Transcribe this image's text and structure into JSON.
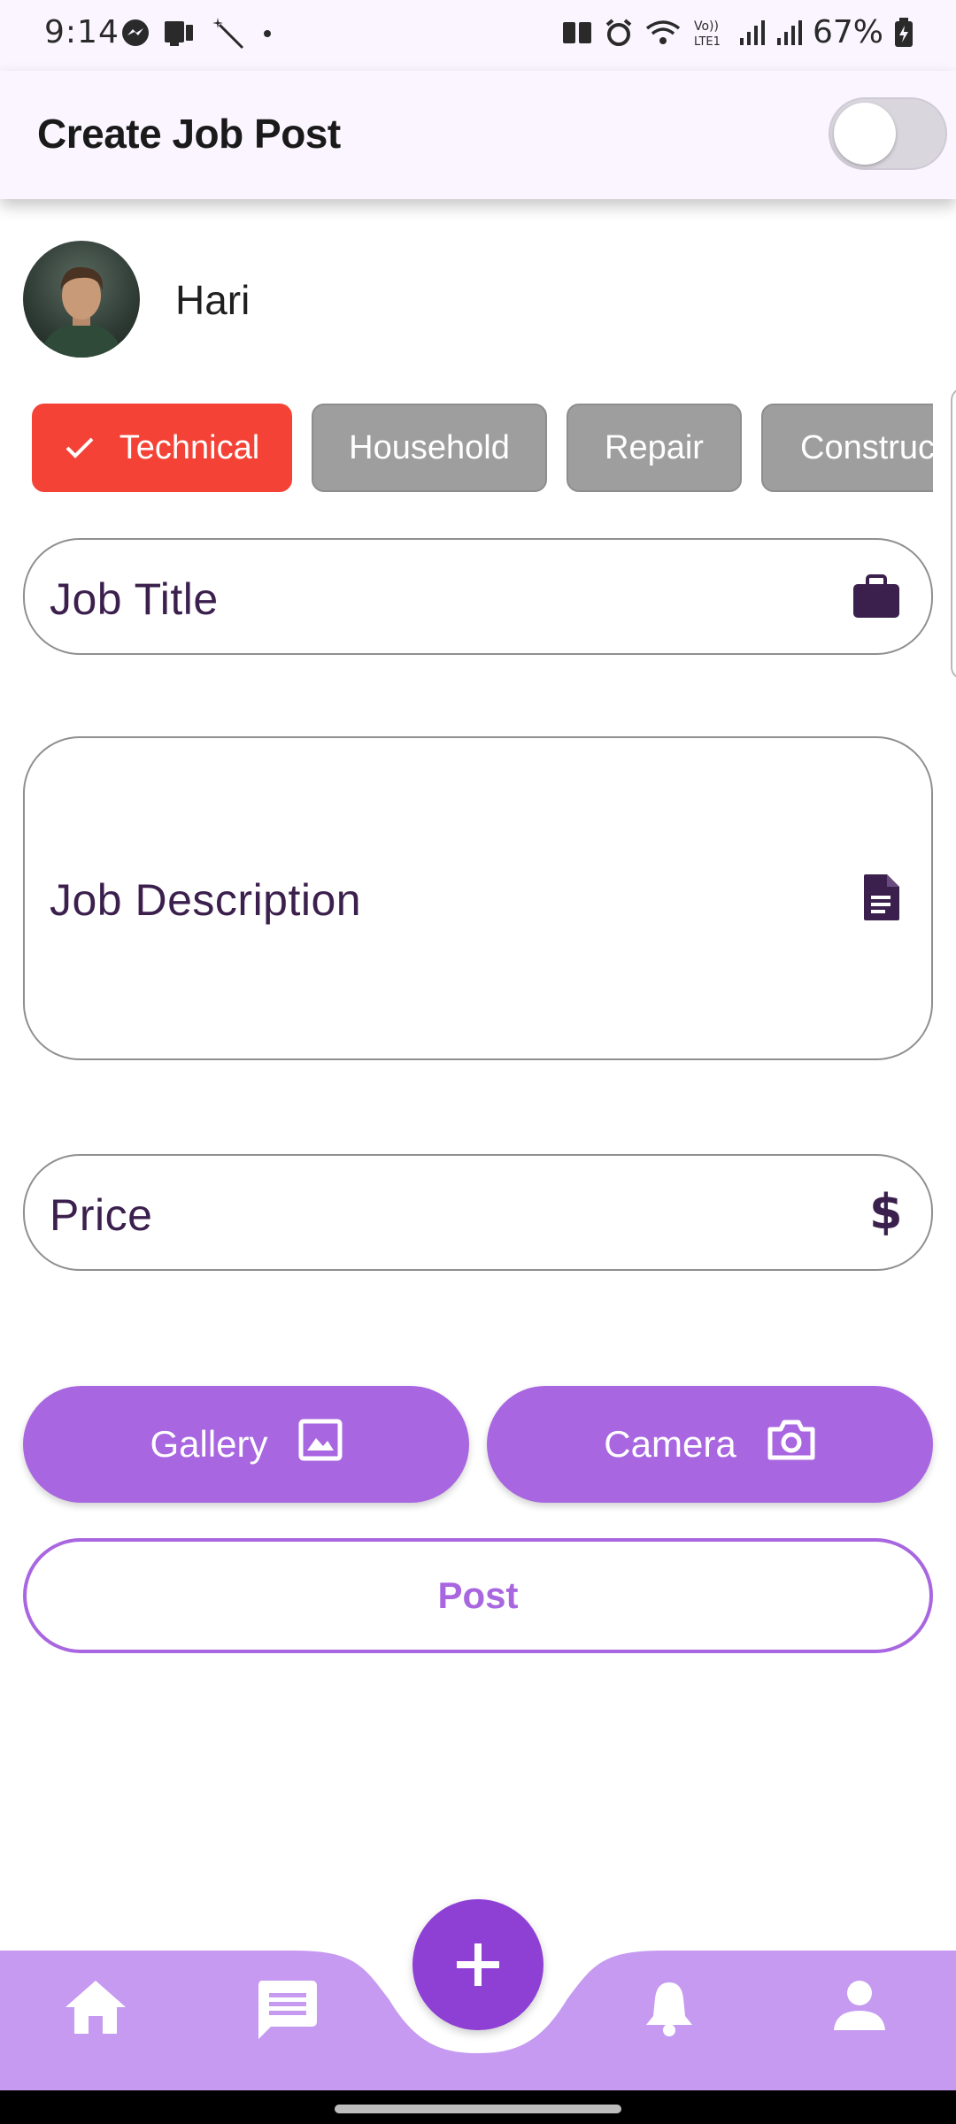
{
  "status_bar": {
    "time": "9:14",
    "battery": "67%"
  },
  "app_bar": {
    "title": "Create Job Post",
    "toggle_on": false
  },
  "user": {
    "name": "Hari"
  },
  "categories": {
    "items": [
      {
        "label": "Technical",
        "selected": true
      },
      {
        "label": "Household",
        "selected": false
      },
      {
        "label": "Repair",
        "selected": false
      },
      {
        "label": "Construct",
        "selected": false
      }
    ]
  },
  "form": {
    "job_title_label": "Job Title",
    "job_title_icon": "briefcase-icon",
    "job_description_label": "Job Description",
    "job_description_icon": "document-icon",
    "price_label": "Price",
    "price_icon": "dollar-icon"
  },
  "actions": {
    "gallery_label": "Gallery",
    "camera_label": "Camera",
    "post_label": "Post"
  },
  "bottom_nav": {
    "items": [
      "home-icon",
      "chat-icon",
      "add-icon",
      "notification-bell-icon",
      "profile-icon"
    ]
  },
  "colors": {
    "accent": "#a866e0",
    "fab": "#8e3fd4",
    "nav_bg": "#c59af0",
    "chip_selected": "#f44336",
    "chip_default": "#9e9e9e",
    "field_text": "#3b1f4d"
  }
}
